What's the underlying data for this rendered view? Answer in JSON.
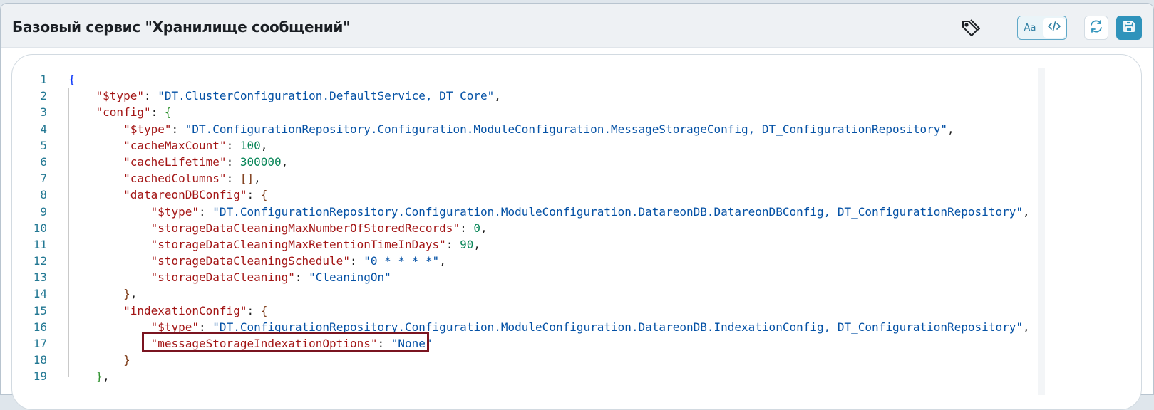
{
  "header": {
    "title": "Базовый сервис \"Хранилище сообщений\"",
    "mode_text_label": "Aa",
    "icons": [
      "tag-icon",
      "code-icon",
      "refresh-icon",
      "save-icon"
    ]
  },
  "colors": {
    "accent": "#2f93bb",
    "highlight_border": "#7a1420",
    "key": "#a31515",
    "string": "#0451a5",
    "number": "#098658"
  },
  "editor": {
    "lines": [
      {
        "n": "1",
        "tokens": [
          [
            "b1",
            "{"
          ]
        ]
      },
      {
        "n": "2",
        "tokens": [
          [
            "pun",
            "    "
          ],
          [
            "key",
            "\"$type\""
          ],
          [
            "pun",
            ": "
          ],
          [
            "str",
            "\"DT.ClusterConfiguration.DefaultService, DT_Core\""
          ],
          [
            "pun",
            ","
          ]
        ]
      },
      {
        "n": "3",
        "tokens": [
          [
            "pun",
            "    "
          ],
          [
            "key",
            "\"config\""
          ],
          [
            "pun",
            ": "
          ],
          [
            "b2",
            "{"
          ]
        ]
      },
      {
        "n": "4",
        "tokens": [
          [
            "pun",
            "        "
          ],
          [
            "key",
            "\"$type\""
          ],
          [
            "pun",
            ": "
          ],
          [
            "str",
            "\"DT.ConfigurationRepository.Configuration.ModuleConfiguration.MessageStorageConfig, DT_ConfigurationRepository\""
          ],
          [
            "pun",
            ","
          ]
        ]
      },
      {
        "n": "5",
        "tokens": [
          [
            "pun",
            "        "
          ],
          [
            "key",
            "\"cacheMaxCount\""
          ],
          [
            "pun",
            ": "
          ],
          [
            "num",
            "100"
          ],
          [
            "pun",
            ","
          ]
        ]
      },
      {
        "n": "6",
        "tokens": [
          [
            "pun",
            "        "
          ],
          [
            "key",
            "\"cacheLifetime\""
          ],
          [
            "pun",
            ": "
          ],
          [
            "num",
            "300000"
          ],
          [
            "pun",
            ","
          ]
        ]
      },
      {
        "n": "7",
        "tokens": [
          [
            "pun",
            "        "
          ],
          [
            "key",
            "\"cachedColumns\""
          ],
          [
            "pun",
            ": "
          ],
          [
            "b3",
            "[]"
          ],
          [
            "pun",
            ","
          ]
        ]
      },
      {
        "n": "8",
        "tokens": [
          [
            "pun",
            "        "
          ],
          [
            "key",
            "\"datareonDBConfig\""
          ],
          [
            "pun",
            ": "
          ],
          [
            "b3",
            "{"
          ]
        ]
      },
      {
        "n": "9",
        "tokens": [
          [
            "pun",
            "            "
          ],
          [
            "key",
            "\"$type\""
          ],
          [
            "pun",
            ": "
          ],
          [
            "str",
            "\"DT.ConfigurationRepository.Configuration.ModuleConfiguration.DatareonDB.DatareonDBConfig, DT_ConfigurationRepository\""
          ],
          [
            "pun",
            ","
          ]
        ]
      },
      {
        "n": "10",
        "tokens": [
          [
            "pun",
            "            "
          ],
          [
            "key",
            "\"storageDataCleaningMaxNumberOfStoredRecords\""
          ],
          [
            "pun",
            ": "
          ],
          [
            "num",
            "0"
          ],
          [
            "pun",
            ","
          ]
        ]
      },
      {
        "n": "11",
        "tokens": [
          [
            "pun",
            "            "
          ],
          [
            "key",
            "\"storageDataCleaningMaxRetentionTimeInDays\""
          ],
          [
            "pun",
            ": "
          ],
          [
            "num",
            "90"
          ],
          [
            "pun",
            ","
          ]
        ]
      },
      {
        "n": "12",
        "tokens": [
          [
            "pun",
            "            "
          ],
          [
            "key",
            "\"storageDataCleaningSchedule\""
          ],
          [
            "pun",
            ": "
          ],
          [
            "str",
            "\"0 * * * *\""
          ],
          [
            "pun",
            ","
          ]
        ]
      },
      {
        "n": "13",
        "tokens": [
          [
            "pun",
            "            "
          ],
          [
            "key",
            "\"storageDataCleaning\""
          ],
          [
            "pun",
            ": "
          ],
          [
            "str",
            "\"CleaningOn\""
          ]
        ]
      },
      {
        "n": "14",
        "tokens": [
          [
            "pun",
            "        "
          ],
          [
            "b3",
            "}"
          ],
          [
            "pun",
            ","
          ]
        ]
      },
      {
        "n": "15",
        "tokens": [
          [
            "pun",
            "        "
          ],
          [
            "key",
            "\"indexationConfig\""
          ],
          [
            "pun",
            ": "
          ],
          [
            "b3",
            "{"
          ]
        ]
      },
      {
        "n": "16",
        "tokens": [
          [
            "pun",
            "            "
          ],
          [
            "key",
            "\"$type\""
          ],
          [
            "pun",
            ": "
          ],
          [
            "str",
            "\"DT.ConfigurationRepository.Configuration.ModuleConfiguration.DatareonDB.IndexationConfig, DT_ConfigurationRepository\""
          ],
          [
            "pun",
            ","
          ]
        ]
      },
      {
        "n": "17",
        "tokens": [
          [
            "pun",
            "            "
          ],
          [
            "key",
            "\"messageStorageIndexationOptions\""
          ],
          [
            "pun",
            ": "
          ],
          [
            "str",
            "\"None\""
          ]
        ]
      },
      {
        "n": "18",
        "tokens": [
          [
            "pun",
            "        "
          ],
          [
            "b3",
            "}"
          ]
        ]
      },
      {
        "n": "19",
        "tokens": [
          [
            "pun",
            "    "
          ],
          [
            "b2",
            "}"
          ],
          [
            "pun",
            ","
          ]
        ]
      }
    ]
  }
}
